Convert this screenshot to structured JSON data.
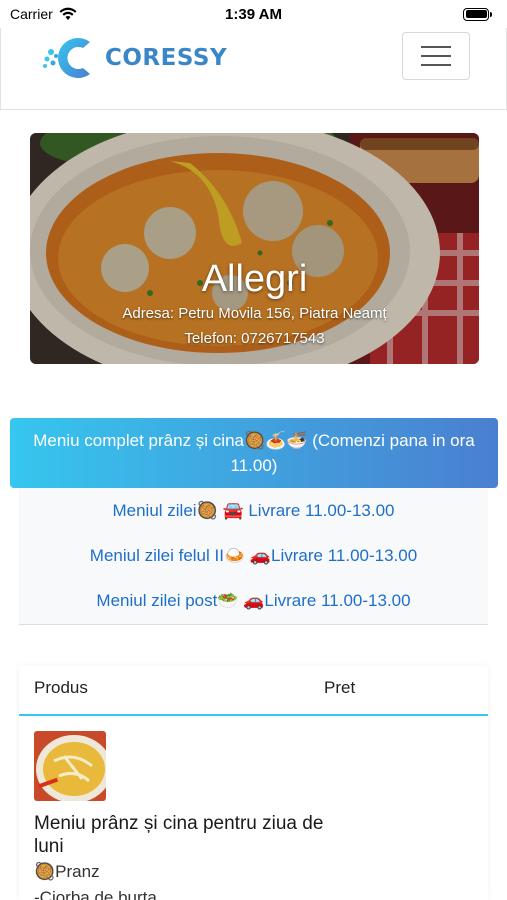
{
  "status_bar": {
    "carrier": "Carrier",
    "time": "1:39 AM"
  },
  "header": {
    "logo_text": "CORESSY"
  },
  "hero": {
    "title": "Allegri",
    "address": "Adresa: Petru Movila 156, Piatra Neamț",
    "phone_label": "Telefon:",
    "phone": "0726717543"
  },
  "menu": {
    "active": "Meniu complet prânz și cina🥘🍝🍜 (Comenzi pana in ora 11.00)",
    "items": [
      {
        "label": "Meniul zilei🥘 🚘 Livrare 11.00-13.00"
      },
      {
        "label": "Meniul zilei felul II🍛 🚗Livrare 11.00-13.00"
      },
      {
        "label": "Meniul zilei post🥗 🚗Livrare 11.00-13.00"
      }
    ]
  },
  "table": {
    "columns": [
      "Produs",
      "Pret"
    ],
    "rows": [
      {
        "name": "Meniu prânz și cina pentru ziua de luni",
        "details": [
          "🥘Pranz",
          "-Ciorba de burta"
        ]
      }
    ]
  },
  "colors": {
    "brand": "#3a86c8",
    "gradient_start": "#36c6ee",
    "gradient_end": "#4a7fd0",
    "link": "#1f6fc9"
  }
}
